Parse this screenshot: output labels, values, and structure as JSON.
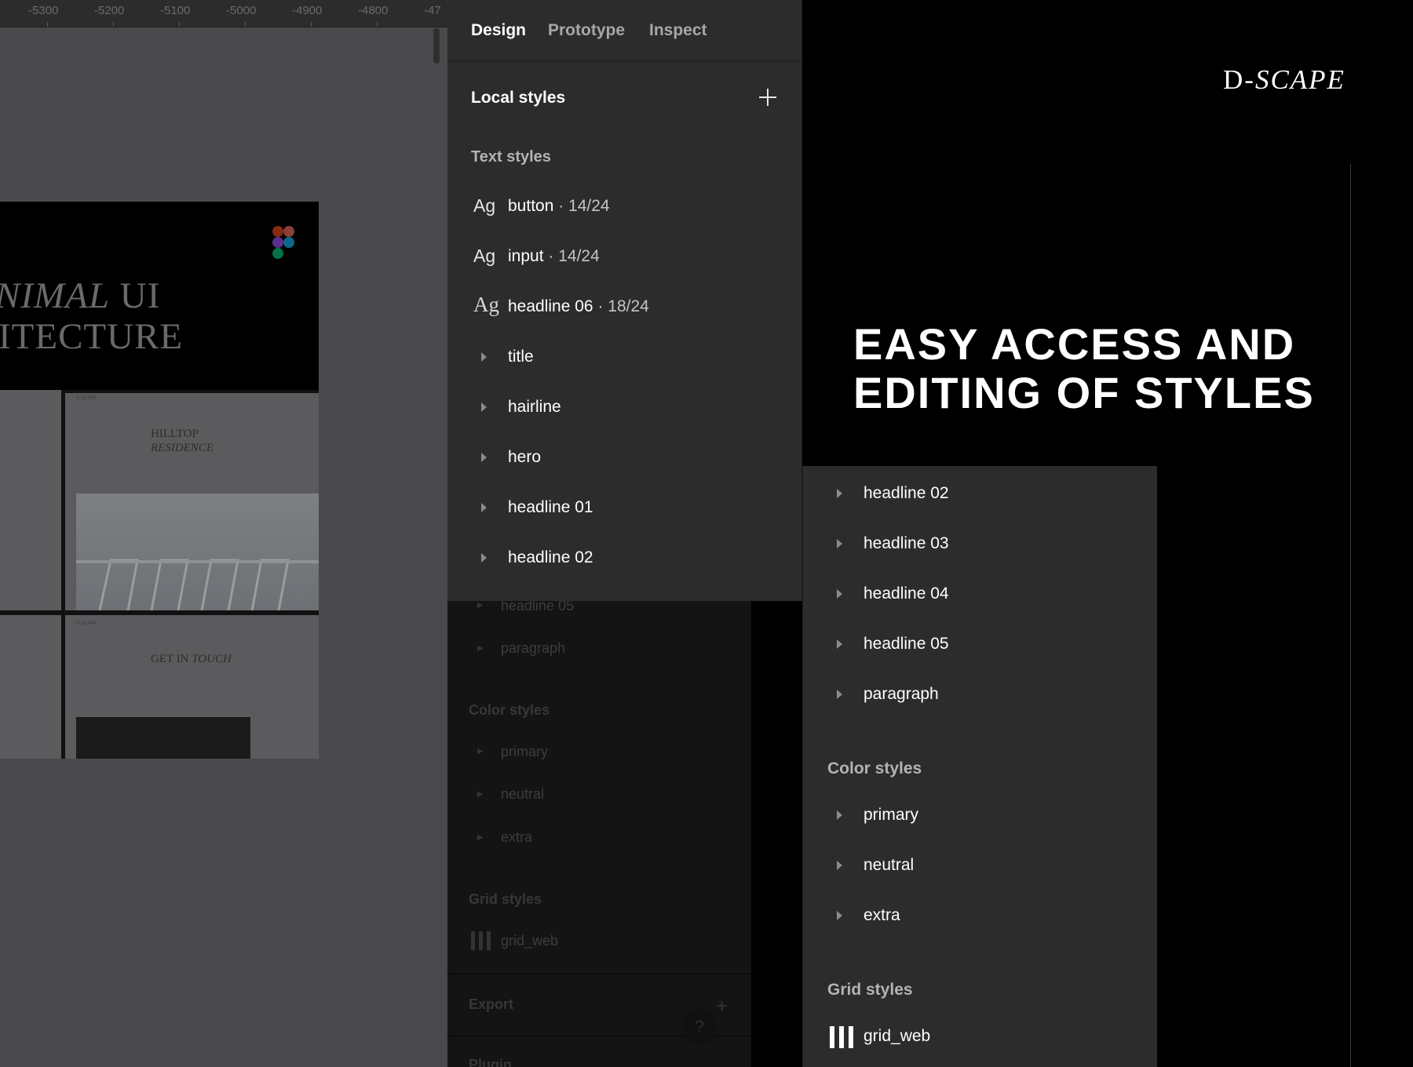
{
  "ruler": {
    "ticks": [
      "-5300",
      "-5200",
      "-5100",
      "-5000",
      "-4900",
      "-4800",
      "-47"
    ]
  },
  "canvas": {
    "hero_line1_italic": "NIMAL",
    "hero_line1_rest": "UI",
    "hero_line2": "ITECTURE",
    "thumb_hilltop_1": "HILLTOP",
    "thumb_hilltop_2": "RESIDENCE",
    "thumb_contact_1": "GET IN",
    "thumb_contact_2": "TOUCH",
    "thumb_brand": "D-SCAPE"
  },
  "tabs": [
    {
      "label": "Design",
      "active": true
    },
    {
      "label": "Prototype",
      "active": false
    },
    {
      "label": "Inspect",
      "active": false
    }
  ],
  "panel": {
    "title": "Local styles",
    "text_styles_label": "Text styles",
    "text_styles": [
      {
        "icon": "Ag",
        "name": "button",
        "meta": "· 14/24"
      },
      {
        "icon": "Ag",
        "name": "input",
        "meta": "· 14/24"
      },
      {
        "icon": "Ag",
        "name": "headline 06",
        "meta": "· 18/24"
      }
    ],
    "groups": [
      "title",
      "hairline",
      "hero",
      "headline 01",
      "headline 02"
    ]
  },
  "dim_panel": {
    "rows": [
      "headline 05",
      "paragraph"
    ],
    "color_label": "Color styles",
    "colors": [
      "primary",
      "neutral",
      "extra"
    ],
    "grid_label": "Grid styles",
    "grid_item": "grid_web",
    "export_label": "Export",
    "plugin_label": "Plugin",
    "help": "?"
  },
  "brand": {
    "logo_prefix": "D-",
    "logo_italic": "SCAPE"
  },
  "headline": {
    "line1": "EASY ACCESS AND",
    "line2": "EDITING OF STYLES"
  },
  "zoom_panel": {
    "groups": [
      "headline 02",
      "headline 03",
      "headline 04",
      "headline 05",
      "paragraph"
    ],
    "color_label": "Color styles",
    "colors": [
      "primary",
      "neutral",
      "extra"
    ],
    "grid_label": "Grid styles",
    "grid_item": "grid_web"
  },
  "colors": {
    "panel_bg": "#2c2c2c",
    "canvas_bg": "#4a4a4d",
    "page_bg": "#000000",
    "text_primary": "#ffffff",
    "text_secondary": "#b3b3b3"
  }
}
